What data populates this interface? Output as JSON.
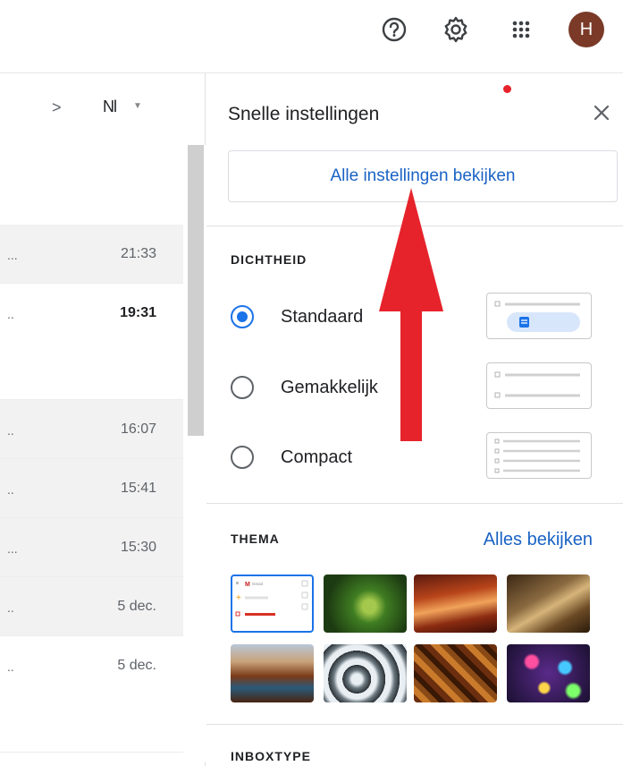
{
  "topbar": {
    "help_icon": "help-circle-icon",
    "settings_icon": "gear-icon",
    "apps_icon": "apps-grid-icon",
    "avatar_initial": "H",
    "avatar_color": "#7a3a27"
  },
  "email_list": {
    "next_icon": ">",
    "sort_label": "Nl",
    "rows": [
      {
        "dots": "...",
        "time": "21:33",
        "bold": false,
        "shaded": true
      },
      {
        "dots": "..",
        "time": "19:31",
        "bold": true,
        "shaded": false
      },
      {
        "dots": "..",
        "time": "16:07",
        "bold": false,
        "shaded": true
      },
      {
        "dots": "..",
        "time": "15:41",
        "bold": false,
        "shaded": true
      },
      {
        "dots": "...",
        "time": "15:30",
        "bold": false,
        "shaded": true
      },
      {
        "dots": "..",
        "time": "5 dec.",
        "bold": false,
        "shaded": true
      },
      {
        "dots": "..",
        "time": "5 dec.",
        "bold": false,
        "shaded": false
      }
    ]
  },
  "quick_settings": {
    "title": "Snelle instellingen",
    "all_settings_button": "Alle instellingen bekijken",
    "density": {
      "heading": "DICHTHEID",
      "options": [
        {
          "label": "Standaard",
          "selected": true
        },
        {
          "label": "Gemakkelijk",
          "selected": false
        },
        {
          "label": "Compact",
          "selected": false
        }
      ]
    },
    "theme": {
      "heading": "THEMA",
      "see_all": "Alles bekijken",
      "thumbnail_logo_text": "M Gmail"
    },
    "inbox_type": {
      "heading": "INBOXTYPE"
    }
  },
  "colors": {
    "accent": "#1a73e8",
    "link": "#1a63c4",
    "arrow": "#e6232b"
  }
}
